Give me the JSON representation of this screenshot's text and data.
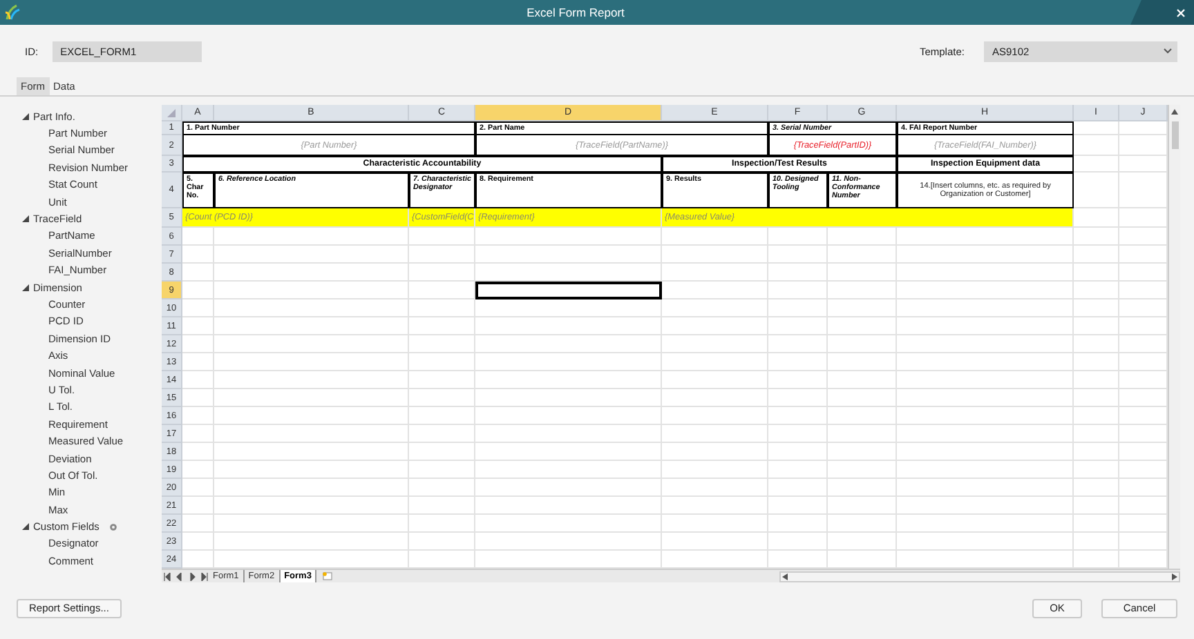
{
  "window": {
    "title": "Excel Form Report"
  },
  "id_field": {
    "label": "ID:",
    "value": "EXCEL_FORM1"
  },
  "template": {
    "label": "Template:",
    "value": "AS9102"
  },
  "tabs": [
    {
      "label": "Form",
      "selected": true
    },
    {
      "label": "Data",
      "selected": false
    }
  ],
  "sidebar": {
    "items": [
      {
        "label": "Part Info.",
        "expanded": true,
        "kind": "standard",
        "children": [
          {
            "label": "Part Number"
          },
          {
            "label": "Serial Number"
          },
          {
            "label": "Revision Number"
          },
          {
            "label": "Stat Count"
          },
          {
            "label": "Unit"
          }
        ]
      },
      {
        "label": "TraceField",
        "expanded": true,
        "kind": "standard",
        "children": [
          {
            "label": "PartName"
          },
          {
            "label": "SerialNumber"
          },
          {
            "label": "FAI_Number"
          }
        ]
      },
      {
        "label": "Dimension",
        "expanded": true,
        "kind": "standard",
        "children": [
          {
            "label": "Counter"
          },
          {
            "label": "PCD ID"
          },
          {
            "label": "Dimension ID"
          },
          {
            "label": "Axis"
          },
          {
            "label": "Nominal Value"
          },
          {
            "label": "U Tol."
          },
          {
            "label": "L Tol."
          },
          {
            "label": "Requirement"
          },
          {
            "label": "Measured Value"
          },
          {
            "label": "Deviation"
          },
          {
            "label": "Out Of Tol."
          },
          {
            "label": "Min"
          },
          {
            "label": "Max"
          }
        ]
      },
      {
        "label": "Custom Fields",
        "expanded": true,
        "kind": "custom",
        "children": [
          {
            "label": "Designator"
          },
          {
            "label": "Comment"
          }
        ]
      }
    ]
  },
  "sheet": {
    "columns": [
      {
        "label": "A",
        "selected": false
      },
      {
        "label": "B",
        "selected": false
      },
      {
        "label": "C",
        "selected": false
      },
      {
        "label": "D",
        "selected": true
      },
      {
        "label": "E",
        "selected": false
      },
      {
        "label": "F",
        "selected": false
      },
      {
        "label": "G",
        "selected": false
      },
      {
        "label": "H",
        "selected": false
      },
      {
        "label": "I",
        "selected": false
      },
      {
        "label": "J",
        "selected": false
      }
    ],
    "rows": [
      {
        "number": "1",
        "selected": false,
        "cells": [
          {
            "text": "1. Part Number",
            "kind": "label"
          },
          {
            "text": "2. Part Name",
            "kind": "label"
          },
          {
            "text": "3. Serial Number",
            "kind": "caption"
          },
          {
            "text": "4. FAI Report Number",
            "kind": "label"
          }
        ]
      },
      {
        "number": "2",
        "selected": false,
        "cells": [
          {
            "text": "{Part Number}",
            "kind": "field",
            "color": "#9a9a9a"
          },
          {
            "text": "{TraceField(PartName)}",
            "kind": "field",
            "color": "#9a9a9a"
          },
          {
            "text": "{TraceField(PartID)}",
            "kind": "field",
            "color": "#e8202a"
          },
          {
            "text": "{TraceField(FAI_Number)}",
            "kind": "field",
            "color": "#9a9a9a"
          }
        ]
      },
      {
        "number": "3",
        "selected": false,
        "cells": [
          {
            "text": "Characteristic Accountability",
            "kind": "section"
          },
          {
            "text": "Inspection/Test Results",
            "kind": "section"
          },
          {
            "text": "Inspection Equipment data",
            "kind": "section"
          }
        ]
      },
      {
        "number": "4",
        "selected": false,
        "cells": [
          {
            "text": "5. Char No.",
            "kind": "label"
          },
          {
            "text": "6. Reference Location",
            "kind": "caption"
          },
          {
            "text": "7. Characteristic Designator",
            "kind": "caption"
          },
          {
            "text": "8. Requirement",
            "kind": "label"
          },
          {
            "text": "9. Results",
            "kind": "label"
          },
          {
            "text": "10. Designed Tooling",
            "kind": "caption"
          },
          {
            "text": "11. Non-Conformance Number",
            "kind": "caption"
          },
          {
            "text": "14.[Insert columns, etc. as required by Organization or Customer]",
            "kind": "note"
          }
        ]
      },
      {
        "number": "5",
        "selected": false,
        "cells": [
          {
            "text": "{Count (PCD ID)}",
            "kind": "binding"
          },
          {
            "text": "{CustomField(C",
            "kind": "binding"
          },
          {
            "text": "{Requirement}",
            "kind": "binding"
          },
          {
            "text": "{Measured Value}",
            "kind": "binding"
          }
        ]
      },
      {
        "number": "6",
        "selected": false
      },
      {
        "number": "7",
        "selected": false
      },
      {
        "number": "8",
        "selected": false
      },
      {
        "number": "9",
        "selected": true
      },
      {
        "number": "10",
        "selected": false
      },
      {
        "number": "11",
        "selected": false
      },
      {
        "number": "12",
        "selected": false
      },
      {
        "number": "13",
        "selected": false
      },
      {
        "number": "14",
        "selected": false
      },
      {
        "number": "15",
        "selected": false
      },
      {
        "number": "16",
        "selected": false
      },
      {
        "number": "17",
        "selected": false
      },
      {
        "number": "18",
        "selected": false
      },
      {
        "number": "19",
        "selected": false
      },
      {
        "number": "20",
        "selected": false
      },
      {
        "number": "21",
        "selected": false
      },
      {
        "number": "22",
        "selected": false
      },
      {
        "number": "23",
        "selected": false
      },
      {
        "number": "24",
        "selected": false
      }
    ],
    "sheet_tabs": [
      {
        "label": "Form1",
        "selected": false
      },
      {
        "label": "Form2",
        "selected": false
      },
      {
        "label": "Form3",
        "selected": true
      }
    ]
  },
  "buttons": {
    "settings": "Report Settings...",
    "ok": "OK",
    "cancel": "Cancel"
  }
}
